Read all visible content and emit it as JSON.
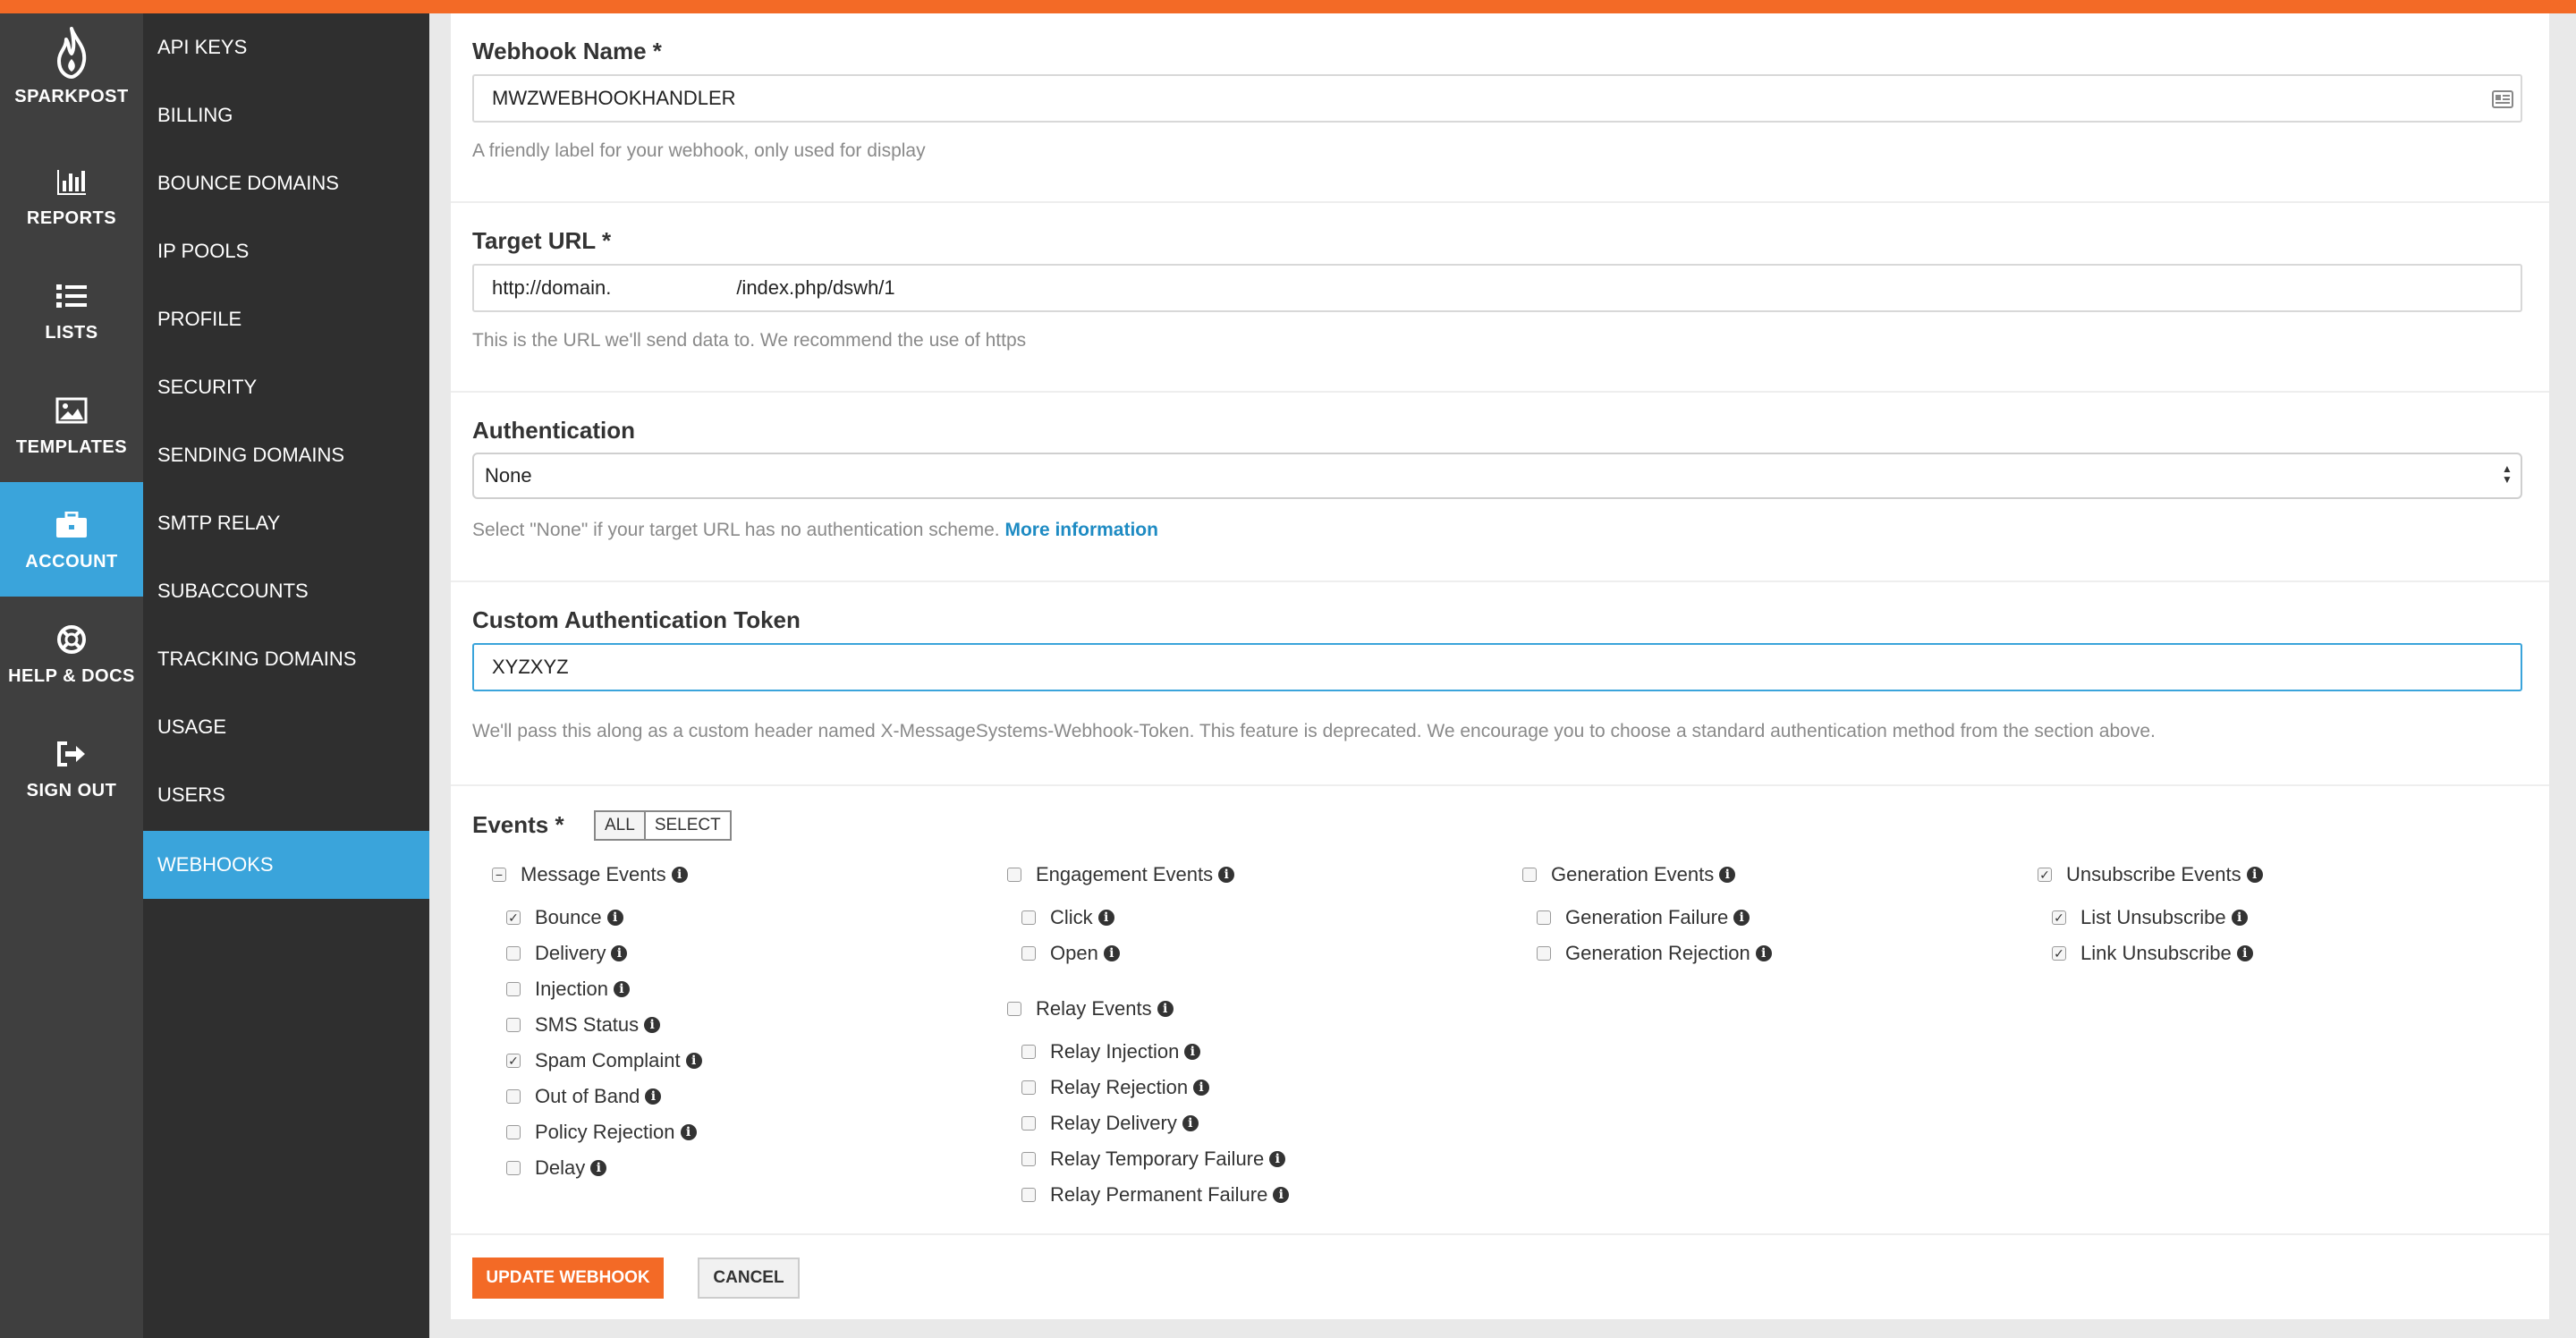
{
  "brand": {
    "name": "SPARKPOST",
    "accent": "#f36a26",
    "active_color": "#3aa4db"
  },
  "rail": {
    "items": [
      {
        "label": "REPORTS",
        "icon": "bar-chart-icon"
      },
      {
        "label": "LISTS",
        "icon": "list-icon"
      },
      {
        "label": "TEMPLATES",
        "icon": "image-icon"
      },
      {
        "label": "ACCOUNT",
        "icon": "briefcase-icon",
        "active": true
      },
      {
        "label": "HELP & DOCS",
        "icon": "lifebuoy-icon"
      },
      {
        "label": "SIGN OUT",
        "icon": "sign-out-icon"
      }
    ]
  },
  "submenu": {
    "items": [
      {
        "label": "API KEYS"
      },
      {
        "label": "BILLING"
      },
      {
        "label": "BOUNCE DOMAINS"
      },
      {
        "label": "IP POOLS"
      },
      {
        "label": "PROFILE"
      },
      {
        "label": "SECURITY"
      },
      {
        "label": "SENDING DOMAINS"
      },
      {
        "label": "SMTP RELAY"
      },
      {
        "label": "SUBACCOUNTS"
      },
      {
        "label": "TRACKING DOMAINS"
      },
      {
        "label": "USAGE"
      },
      {
        "label": "USERS"
      },
      {
        "label": "WEBHOOKS",
        "active": true
      }
    ]
  },
  "form": {
    "webhook_name": {
      "label": "Webhook Name *",
      "value": "MWZWEBHOOKHANDLER",
      "help": "A friendly label for your webhook, only used for display"
    },
    "target_url": {
      "label": "Target URL *",
      "value": "http://domain.[redacted]/index.php/dswh/1",
      "value_prefix": "http://domain.",
      "value_suffix": "/index.php/dswh/1",
      "help": "This is the URL we'll send data to. We recommend the use of https"
    },
    "authentication": {
      "label": "Authentication",
      "selected": "None",
      "help": "Select \"None\" if your target URL has no authentication scheme.",
      "help_link": "More information"
    },
    "custom_token": {
      "label": "Custom Authentication Token",
      "value": "XYZXYZ",
      "help": "We'll pass this along as a custom header named X-MessageSystems-Webhook-Token. This feature is deprecated. We encourage you to choose a standard authentication method from the section above."
    }
  },
  "events": {
    "label": "Events *",
    "toggle": {
      "all": "ALL",
      "select": "SELECT"
    },
    "message": {
      "label": "Message Events",
      "state": "indeterminate",
      "items": [
        {
          "label": "Bounce",
          "checked": true
        },
        {
          "label": "Delivery",
          "checked": false
        },
        {
          "label": "Injection",
          "checked": false
        },
        {
          "label": "SMS Status",
          "checked": false
        },
        {
          "label": "Spam Complaint",
          "checked": true
        },
        {
          "label": "Out of Band",
          "checked": false
        },
        {
          "label": "Policy Rejection",
          "checked": false
        },
        {
          "label": "Delay",
          "checked": false
        }
      ]
    },
    "engagement": {
      "label": "Engagement Events",
      "state": "unchecked",
      "items": [
        {
          "label": "Click",
          "checked": false
        },
        {
          "label": "Open",
          "checked": false
        }
      ]
    },
    "relay": {
      "label": "Relay Events",
      "state": "unchecked",
      "items": [
        {
          "label": "Relay Injection",
          "checked": false
        },
        {
          "label": "Relay Rejection",
          "checked": false
        },
        {
          "label": "Relay Delivery",
          "checked": false
        },
        {
          "label": "Relay Temporary Failure",
          "checked": false
        },
        {
          "label": "Relay Permanent Failure",
          "checked": false
        }
      ]
    },
    "generation": {
      "label": "Generation Events",
      "state": "unchecked",
      "items": [
        {
          "label": "Generation Failure",
          "checked": false
        },
        {
          "label": "Generation Rejection",
          "checked": false
        }
      ]
    },
    "unsubscribe": {
      "label": "Unsubscribe Events",
      "state": "checked",
      "items": [
        {
          "label": "List Unsubscribe",
          "checked": true
        },
        {
          "label": "Link Unsubscribe",
          "checked": true
        }
      ]
    }
  },
  "actions": {
    "update": "UPDATE WEBHOOK",
    "cancel": "CANCEL"
  }
}
